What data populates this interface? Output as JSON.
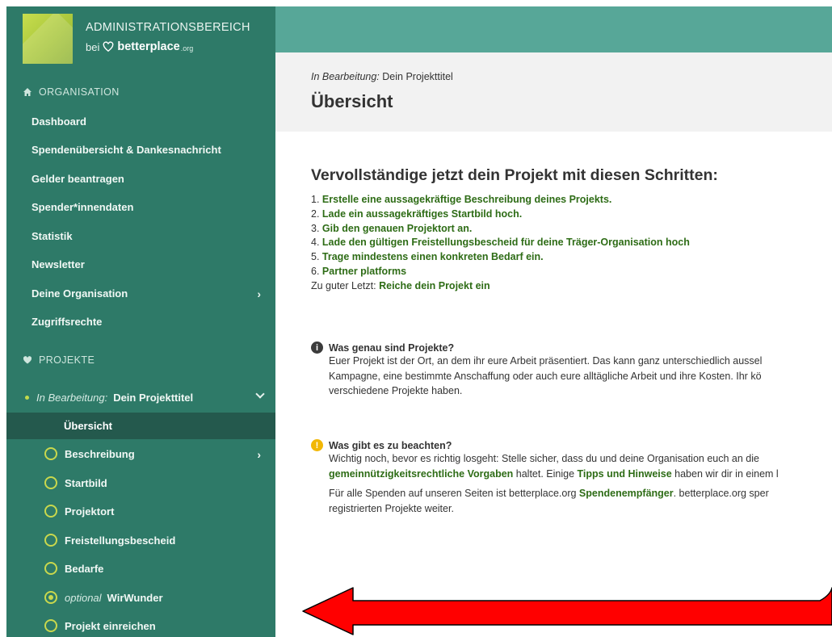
{
  "brand": {
    "title": "ADMINISTRATIONSBEREICH",
    "by": "bei",
    "name": "betterplace",
    "tld": ".org"
  },
  "sidebar": {
    "org_heading": "ORGANISATION",
    "org_items": [
      {
        "label": "Dashboard"
      },
      {
        "label": "Spendenübersicht & Dankesnachricht"
      },
      {
        "label": "Gelder beantragen"
      },
      {
        "label": "Spender*innendaten"
      },
      {
        "label": "Statistik"
      },
      {
        "label": "Newsletter"
      },
      {
        "label": "Deine Organisation",
        "chevron": "›"
      },
      {
        "label": "Zugriffsrechte"
      }
    ],
    "proj_heading": "PROJEKTE",
    "project": {
      "status": "In Bearbeitung:",
      "title": "Dein Projekttitel"
    },
    "active_sub": "Übersicht",
    "steps": [
      {
        "label": "Beschreibung",
        "chevron": "›"
      },
      {
        "label": "Startbild"
      },
      {
        "label": "Projektort"
      },
      {
        "label": "Freistellungsbescheid"
      },
      {
        "label": "Bedarfe"
      },
      {
        "label": "WirWunder",
        "optional": "optional"
      },
      {
        "label": "Projekt einreichen"
      }
    ]
  },
  "header": {
    "status": "In Bearbeitung:",
    "project": "Dein Projekttitel",
    "title": "Übersicht"
  },
  "main": {
    "heading": "Vervollständige jetzt dein Projekt mit diesen Schritten:",
    "steps": [
      {
        "num": "1.",
        "link": "Erstelle eine aussagekräftige Beschreibung deines Projekts."
      },
      {
        "num": "2.",
        "link": "Lade ein aussagekräftiges Startbild hoch."
      },
      {
        "num": "3.",
        "link": "Gib den genauen Projektort an."
      },
      {
        "num": "4.",
        "link": "Lade den gültigen Freistellungsbescheid für deine Träger-Organisation hoch"
      },
      {
        "num": "5.",
        "link": "Trage mindestens einen konkreten Bedarf ein."
      },
      {
        "num": "6.",
        "link": "Partner platforms"
      }
    ],
    "final_prefix": "Zu guter Letzt:",
    "final_link": "Reiche dein Projekt ein",
    "info1": {
      "title": "Was genau sind Projekte?",
      "line1": "Euer Projekt ist der Ort, an dem ihr eure Arbeit präsentiert. Das kann ganz unterschiedlich aussel",
      "line2": "Kampagne, eine bestimmte Anschaffung oder auch eure alltägliche Arbeit und ihre Kosten. Ihr kö",
      "line3": "verschiedene Projekte haben."
    },
    "info2": {
      "title": "Was gibt es zu beachten?",
      "line1": "Wichtig noch, bevor es richtig losgeht: Stelle sicher, dass du und deine Organisation euch an die",
      "line2_link1": "gemeinnützigkeitsrechtliche Vorgaben",
      "line2_mid": " haltet. Einige ",
      "line2_link2": "Tipps und Hinweise",
      "line2_end": " haben wir dir in einem l",
      "line3_pre": "Für alle Spenden auf unseren Seiten ist betterplace.org ",
      "line3_link": "Spendenempfänger",
      "line3_post": ". betterplace.org sper",
      "line4": "registrierten Projekte weiter."
    }
  },
  "colors": {
    "sidebar": "#2e7a68",
    "sidebar_active": "#24594d",
    "topbar": "#57a798",
    "link": "#2e6c16",
    "ring": "#c9d84d",
    "arrow": "#ff0000"
  }
}
